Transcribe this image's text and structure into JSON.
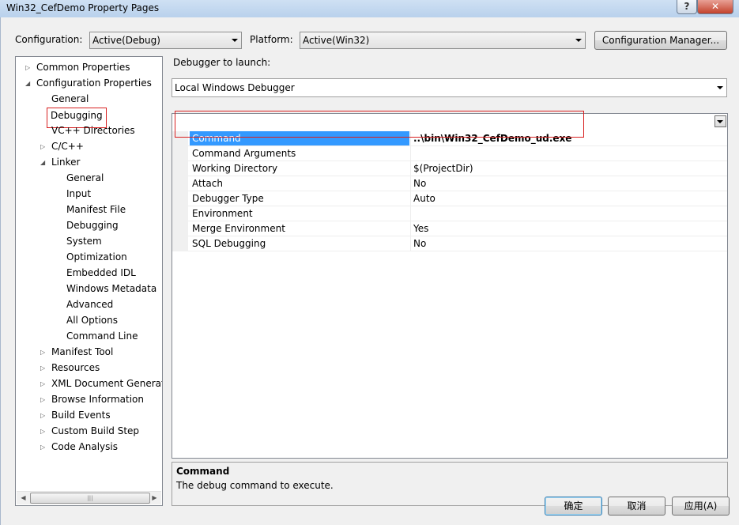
{
  "window": {
    "title": "Win32_CefDemo Property Pages",
    "help_glyph": "?",
    "close_glyph": "✕"
  },
  "toolbar": {
    "configuration_label": "Configuration:",
    "configuration_value": "Active(Debug)",
    "platform_label": "Platform:",
    "platform_value": "Active(Win32)",
    "config_manager_label": "Configuration Manager..."
  },
  "tree": {
    "items": [
      {
        "label": "Common Properties",
        "expander": "▷"
      },
      {
        "label": "Configuration Properties",
        "expander": "◢"
      },
      {
        "label": "General",
        "expander": ""
      },
      {
        "label": "Debugging",
        "expander": ""
      },
      {
        "label": "VC++ Directories",
        "expander": ""
      },
      {
        "label": "C/C++",
        "expander": "▷"
      },
      {
        "label": "Linker",
        "expander": "◢"
      },
      {
        "label": "General",
        "expander": ""
      },
      {
        "label": "Input",
        "expander": ""
      },
      {
        "label": "Manifest File",
        "expander": ""
      },
      {
        "label": "Debugging",
        "expander": ""
      },
      {
        "label": "System",
        "expander": ""
      },
      {
        "label": "Optimization",
        "expander": ""
      },
      {
        "label": "Embedded IDL",
        "expander": ""
      },
      {
        "label": "Windows Metadata",
        "expander": ""
      },
      {
        "label": "Advanced",
        "expander": ""
      },
      {
        "label": "All Options",
        "expander": ""
      },
      {
        "label": "Command Line",
        "expander": ""
      },
      {
        "label": "Manifest Tool",
        "expander": "▷"
      },
      {
        "label": "Resources",
        "expander": "▷"
      },
      {
        "label": "XML Document Generat",
        "expander": "▷"
      },
      {
        "label": "Browse Information",
        "expander": "▷"
      },
      {
        "label": "Build Events",
        "expander": "▷"
      },
      {
        "label": "Custom Build Step",
        "expander": "▷"
      },
      {
        "label": "Code Analysis",
        "expander": "▷"
      }
    ],
    "scroll_left": "◀",
    "scroll_right": "▶",
    "scroll_grip": "|||"
  },
  "debugger": {
    "launch_label": "Debugger to launch:",
    "selected": "Local Windows Debugger"
  },
  "grid": {
    "rows": [
      {
        "name": "Command",
        "value": "..\\bin\\Win32_CefDemo_ud.exe"
      },
      {
        "name": "Command Arguments",
        "value": ""
      },
      {
        "name": "Working Directory",
        "value": "$(ProjectDir)"
      },
      {
        "name": "Attach",
        "value": "No"
      },
      {
        "name": "Debugger Type",
        "value": "Auto"
      },
      {
        "name": "Environment",
        "value": ""
      },
      {
        "name": "Merge Environment",
        "value": "Yes"
      },
      {
        "name": "SQL Debugging",
        "value": "No"
      }
    ]
  },
  "description": {
    "title": "Command",
    "text": "The debug command to execute."
  },
  "buttons": {
    "ok": "确定",
    "cancel": "取消",
    "apply": "应用(A)"
  },
  "colors": {
    "selection": "#3399ff",
    "highlight_box": "#d82020"
  }
}
